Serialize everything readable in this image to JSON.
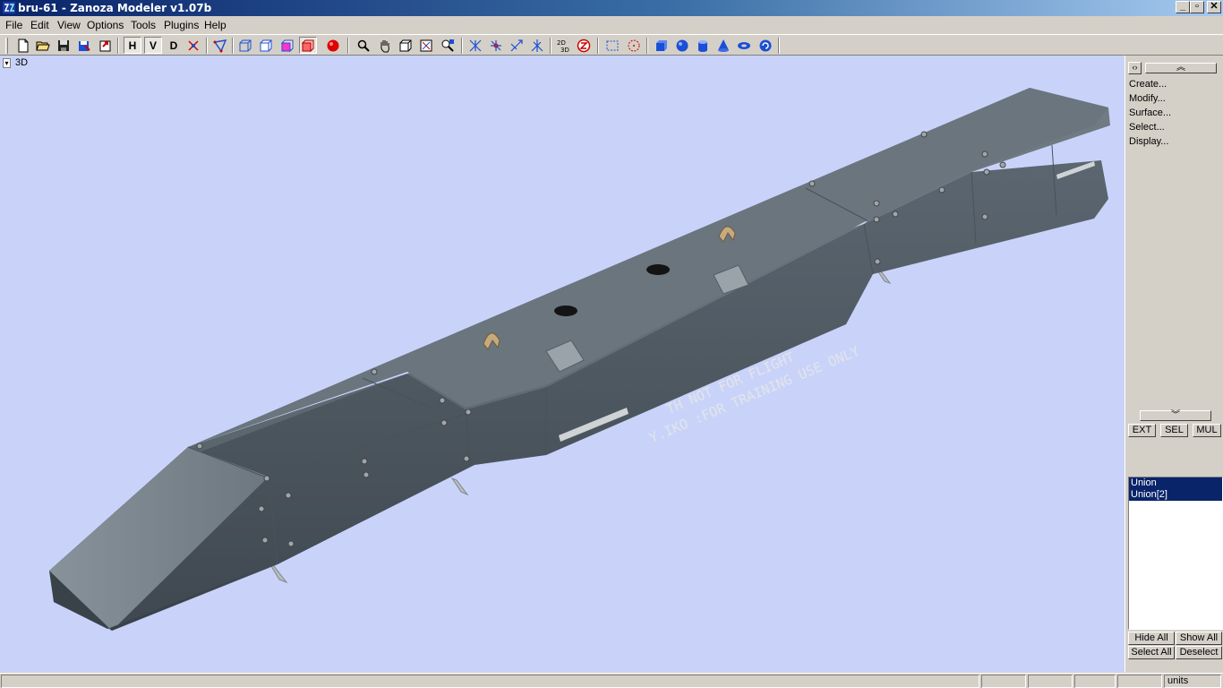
{
  "window": {
    "title": "bru-61 - Zanoza Modeler v1.07b"
  },
  "menu": [
    "File",
    "Edit",
    "View",
    "Options",
    "Tools",
    "Plugins",
    "Help"
  ],
  "toolbar": {
    "h_label": "H",
    "v_label": "V",
    "d_label": "D"
  },
  "viewport": {
    "label": "3D"
  },
  "stencil": {
    "line1": "TH     NOT FOR FLIGHT",
    "line2": "Y.IKO :FOR TRAINING USE ONLY"
  },
  "panel": {
    "menu": [
      "Create...",
      "Modify...",
      "Surface...",
      "Select...",
      "Display..."
    ],
    "mode_buttons": [
      "EXT",
      "SEL",
      "MUL"
    ],
    "list": [
      "Union",
      "Union[2]"
    ],
    "hide_all": "Hide All",
    "show_all": "Show All",
    "select_all": "Select All",
    "deselect": "Deselect"
  },
  "status": {
    "units": "units"
  },
  "colors": {
    "viewport_bg": "#c9d3fa",
    "model_body": "#5f6b75",
    "selection": "#0a246a"
  }
}
